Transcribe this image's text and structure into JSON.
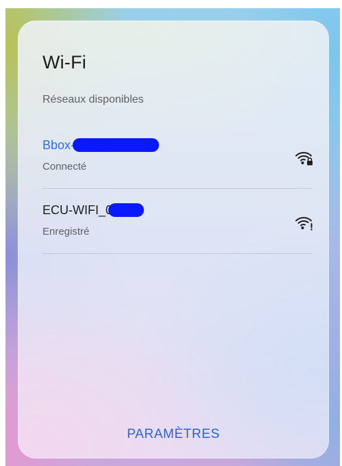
{
  "panel": {
    "title": "Wi-Fi",
    "section_label": "Réseaux disponibles"
  },
  "networks": [
    {
      "name": "Bbox-",
      "status": "Connecté",
      "name_color": "#2f6fe4",
      "icon": "wifi-locked-icon"
    },
    {
      "name": "ECU-WIFI_0",
      "status": "Enregistré",
      "name_color": "#1d1d1d",
      "icon": "wifi-warning-icon"
    }
  ],
  "footer": {
    "settings_label": "PARAMÈTRES"
  },
  "colors": {
    "accent": "#2a63d9",
    "redaction": "#0a18ff",
    "text_primary": "#1b1b1b",
    "text_secondary": "#5f6166"
  }
}
